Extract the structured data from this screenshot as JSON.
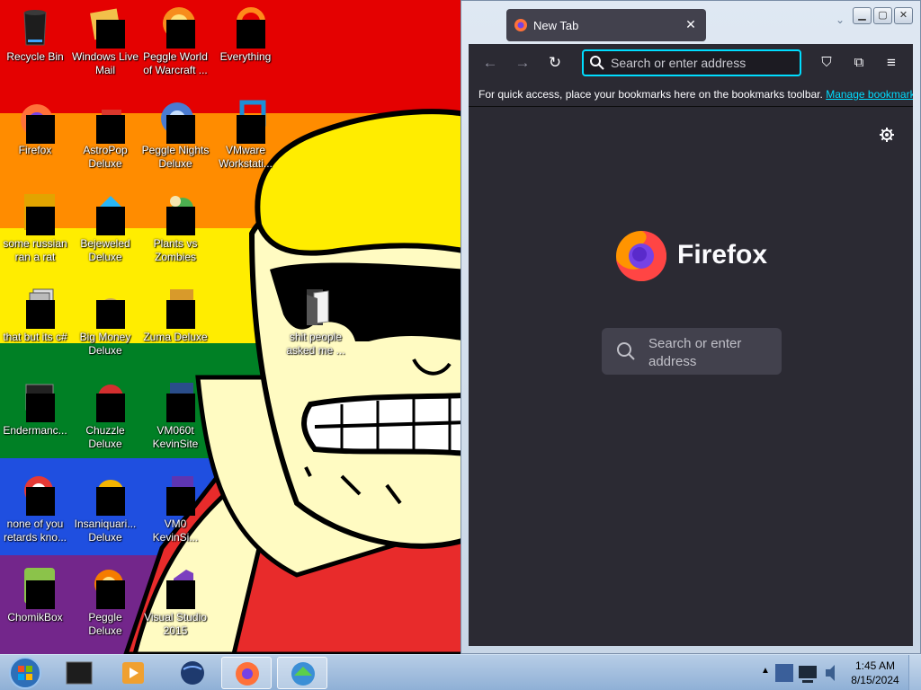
{
  "desktop": {
    "icons": [
      {
        "label": "Recycle Bin"
      },
      {
        "label": "Windows Live Mail"
      },
      {
        "label": "Peggle World of Warcraft ..."
      },
      {
        "label": "Everything"
      },
      {
        "label": "Firefox"
      },
      {
        "label": "AstroPop Deluxe"
      },
      {
        "label": "Peggle Nights Deluxe"
      },
      {
        "label": "VMware Workstati..."
      },
      {
        "label": "some russian ran a rat"
      },
      {
        "label": "Bejeweled Deluxe"
      },
      {
        "label": "Plants vs Zombies"
      },
      {
        "label": "that but its c#"
      },
      {
        "label": "Big Money Deluxe"
      },
      {
        "label": "Zuma Deluxe"
      },
      {
        "label": "shit people asked me ..."
      },
      {
        "label": "Endermanc..."
      },
      {
        "label": "Chuzzle Deluxe"
      },
      {
        "label": "VM060t KevinSite"
      },
      {
        "label": "none of you retards kno..."
      },
      {
        "label": "Insaniquari... Deluxe"
      },
      {
        "label": "VM0 KevinSi..."
      },
      {
        "label": "ChomikBox"
      },
      {
        "label": "Peggle Deluxe"
      },
      {
        "label": "Visual Studio 2015"
      }
    ]
  },
  "browser": {
    "tab_title": "New Tab",
    "close_tab_icon": "close-icon",
    "window_buttons": [
      "minimize-icon",
      "maximize-icon",
      "close-icon"
    ],
    "nav": {
      "back_icon": "arrow-left-icon",
      "forward_icon": "arrow-right-icon",
      "reload_icon": "reload-icon"
    },
    "url_placeholder": "Search or enter address",
    "toolbar_icons": [
      "pocket-icon",
      "extensions-icon",
      "menu-icon"
    ],
    "bookmarks_message": "For quick access, place your bookmarks here on the bookmarks toolbar.",
    "bookmarks_link": "Manage bookmarks",
    "newtab": {
      "wordmark": "Firefox",
      "search_placeholder": "Search or enter address"
    }
  },
  "taskbar": {
    "clock_time": "1:45 AM",
    "clock_date": "8/15/2024"
  },
  "colors": {
    "accent": "#00ddff",
    "browser_bg": "#2b2a33",
    "tab_bg": "#42414d"
  }
}
